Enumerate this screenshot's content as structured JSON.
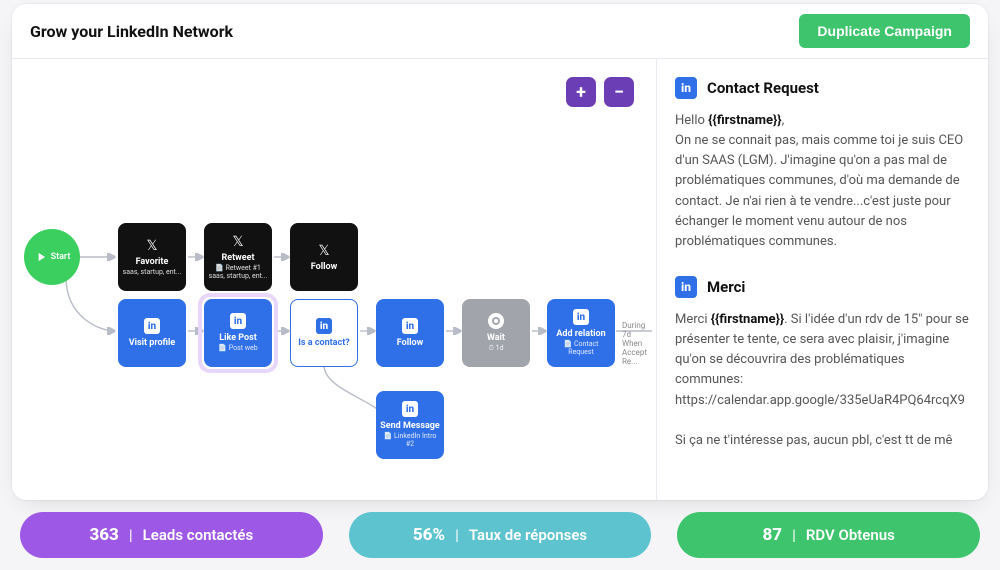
{
  "header": {
    "title": "Grow your LinkedIn Network",
    "duplicate_button": "Duplicate Campaign"
  },
  "zoom": {
    "plus": "+",
    "minus": "−"
  },
  "flow": {
    "start": {
      "label": "Start"
    },
    "favorite": {
      "title": "Favorite",
      "sub": "saas, startup, ent..."
    },
    "retweet": {
      "title": "Retweet",
      "sub": "📄 Retweet #1\nsaas, startup, ent..."
    },
    "follow_x": {
      "title": "Follow",
      "sub": ""
    },
    "visit": {
      "title": "Visit profile",
      "sub": ""
    },
    "like": {
      "title": "Like Post",
      "sub": "📄 Post web"
    },
    "is_contact": {
      "title": "Is a contact?",
      "sub": ""
    },
    "follow_li": {
      "title": "Follow",
      "sub": ""
    },
    "wait": {
      "title": "Wait",
      "sub": "⏱ 1d"
    },
    "add_relation": {
      "title": "Add relation",
      "sub": "📄 Contact Request"
    },
    "send_msg": {
      "title": "Send Message",
      "sub": "📄 LinkedIn Intro #2"
    },
    "trace_right": "During 7d\nWhen Accept Re..."
  },
  "panel": {
    "blocks": [
      {
        "title": "Contact Request",
        "body_before": "Hello ",
        "bold": "{{firstname}}",
        "body_after": ",\nOn ne se connait pas, mais comme toi je suis CEO d'un SAAS (LGM). J'imagine qu'on a pas mal de problématiques communes, d'où ma demande de contact. Je n'ai rien à te vendre...c'est juste pour échanger le moment venu autour de nos problématiques communes."
      },
      {
        "title": "Merci",
        "body_before": "Merci ",
        "bold": "{{firstname}}",
        "body_after": ". Si l'idée d'un rdv de 15\" pour se présenter te tente, ce sera avec plaisir, j'imagine qu'on se découvrira des problématiques communes: https://calendar.app.google/335eUaR4PQ64rcqX9\n\nSi ça ne t'intéresse pas, aucun pbl, c'est tt de mê"
      }
    ]
  },
  "stats": {
    "leads": {
      "value": "363",
      "label": "Leads contactés"
    },
    "response": {
      "value": "56%",
      "label": "Taux de réponses"
    },
    "rdv": {
      "value": "87",
      "label": "RDV Obtenus"
    }
  },
  "colors": {
    "accent_purple": "#6c3eb5",
    "brand_green": "#3dc46c",
    "node_blue": "#2f6fe8",
    "node_gray": "#a2a4ac",
    "pill_purple": "#9d59e6",
    "pill_teal": "#5dc3cf"
  }
}
